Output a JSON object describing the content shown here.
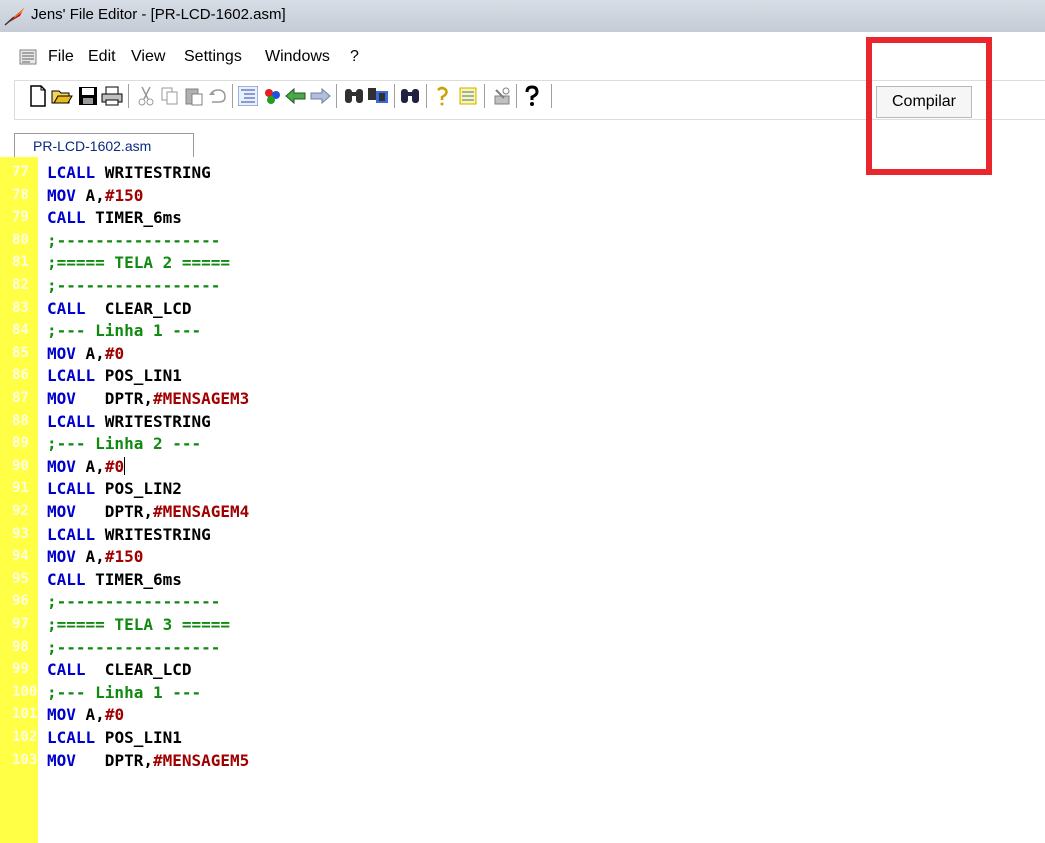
{
  "window": {
    "title": "Jens' File Editor - [PR-LCD-1602.asm]"
  },
  "menu": {
    "items": [
      "File",
      "Edit",
      "View",
      "Settings",
      "Windows",
      "?"
    ]
  },
  "toolbar": {
    "buttons": [
      "new-file-icon",
      "open-folder-icon",
      "save-icon",
      "print-icon",
      "cut-icon",
      "copy-icon",
      "paste-icon",
      "undo-icon",
      "list-icon",
      "color-icon",
      "back-icon",
      "forward-icon",
      "find-icon",
      "find-replace-icon",
      "find-next-icon",
      "goto-icon",
      "syntax-icon",
      "tools-icon",
      "help-icon"
    ],
    "compile_label": "Compilar"
  },
  "tabs": {
    "active": "PR-LCD-1602.asm"
  },
  "colors": {
    "keyword": "#0000cc",
    "number": "#a00000",
    "comment": "#108a10",
    "gutter": "#ffff46",
    "highlight": "#e8262c"
  },
  "code": {
    "lines": [
      {
        "num": "77",
        "kw": "LCALL",
        "arg": " WRITESTRING",
        "val": "",
        "cm": ""
      },
      {
        "num": "78",
        "kw": "MOV",
        "arg": " A,",
        "val": "#150",
        "cm": ""
      },
      {
        "num": "79",
        "kw": "CALL",
        "arg": " TIMER_6ms",
        "val": "",
        "cm": ""
      },
      {
        "num": "80",
        "kw": "",
        "arg": "",
        "val": "",
        "cm": ";-----------------"
      },
      {
        "num": "81",
        "kw": "",
        "arg": "",
        "val": "",
        "cm": ";===== TELA 2 ====="
      },
      {
        "num": "82",
        "kw": "",
        "arg": "",
        "val": "",
        "cm": ";-----------------"
      },
      {
        "num": "83",
        "kw": "CALL",
        "arg": "  CLEAR_LCD",
        "val": "",
        "cm": ""
      },
      {
        "num": "84",
        "kw": "",
        "arg": "",
        "val": "",
        "cm": ";--- Linha 1 ---"
      },
      {
        "num": "85",
        "kw": "MOV",
        "arg": " A,",
        "val": "#0",
        "cm": ""
      },
      {
        "num": "86",
        "kw": "LCALL",
        "arg": " POS_LIN1",
        "val": "",
        "cm": ""
      },
      {
        "num": "87",
        "kw": "MOV",
        "arg": "   DPTR,",
        "val": "#MENSAGEM3",
        "cm": ""
      },
      {
        "num": "88",
        "kw": "LCALL",
        "arg": " WRITESTRING",
        "val": "",
        "cm": ""
      },
      {
        "num": "89",
        "kw": "",
        "arg": "",
        "val": "",
        "cm": ";--- Linha 2 ---"
      },
      {
        "num": "90",
        "kw": "MOV",
        "arg": " A,",
        "val": "#0",
        "cm": "",
        "caret": true
      },
      {
        "num": "91",
        "kw": "LCALL",
        "arg": " POS_LIN2",
        "val": "",
        "cm": ""
      },
      {
        "num": "92",
        "kw": "MOV",
        "arg": "   DPTR,",
        "val": "#MENSAGEM4",
        "cm": ""
      },
      {
        "num": "93",
        "kw": "LCALL",
        "arg": " WRITESTRING",
        "val": "",
        "cm": ""
      },
      {
        "num": "94",
        "kw": "MOV",
        "arg": " A,",
        "val": "#150",
        "cm": ""
      },
      {
        "num": "95",
        "kw": "CALL",
        "arg": " TIMER_6ms",
        "val": "",
        "cm": ""
      },
      {
        "num": "96",
        "kw": "",
        "arg": "",
        "val": "",
        "cm": ";-----------------"
      },
      {
        "num": "97",
        "kw": "",
        "arg": "",
        "val": "",
        "cm": ";===== TELA 3 ====="
      },
      {
        "num": "98",
        "kw": "",
        "arg": "",
        "val": "",
        "cm": ";-----------------"
      },
      {
        "num": "99",
        "kw": "CALL",
        "arg": "  CLEAR_LCD",
        "val": "",
        "cm": ""
      },
      {
        "num": "100",
        "kw": "",
        "arg": "",
        "val": "",
        "cm": ";--- Linha 1 ---"
      },
      {
        "num": "101",
        "kw": "MOV",
        "arg": " A,",
        "val": "#0",
        "cm": ""
      },
      {
        "num": "102",
        "kw": "LCALL",
        "arg": " POS_LIN1",
        "val": "",
        "cm": ""
      },
      {
        "num": "103",
        "kw": "MOV",
        "arg": "   DPTR,",
        "val": "#MENSAGEM5",
        "cm": ""
      }
    ]
  }
}
